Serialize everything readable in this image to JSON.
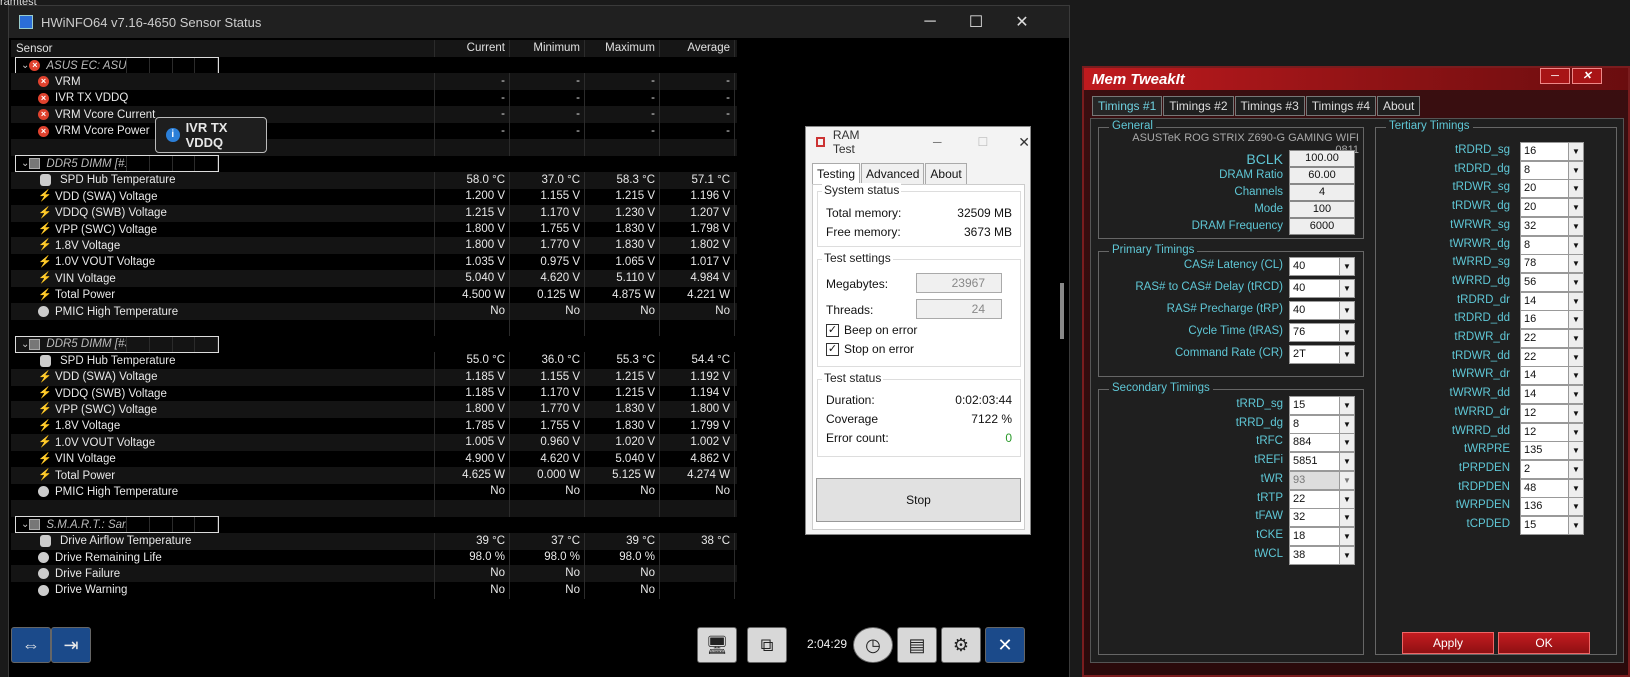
{
  "bg": {
    "text": "ramtest"
  },
  "hw": {
    "title": "HWiNFO64 v7.16-4650 Sensor Status",
    "columns": [
      "Sensor",
      "Current",
      "Minimum",
      "Maximum",
      "Average"
    ],
    "rows": [
      {
        "name": "ASUS EC: ASUS",
        "group": true,
        "icon": "x"
      },
      {
        "name": "VRM",
        "icon": "x",
        "cur": "-",
        "min": "-",
        "max": "-",
        "avg": "-"
      },
      {
        "name": "IVR TX VDDQ",
        "icon": "x",
        "cur": "-",
        "min": "-",
        "max": "-",
        "avg": "-"
      },
      {
        "name": "VRM Vcore Current",
        "icon": "x",
        "cur": "-",
        "min": "-",
        "max": "-",
        "avg": "-"
      },
      {
        "name": "VRM Vcore Power",
        "icon": "x",
        "cur": "-",
        "min": "-",
        "max": "-",
        "avg": "-"
      },
      {
        "name": "",
        "blank": true
      },
      {
        "name": "DDR5 DIMM [#1] (BANK 0/Controller1-DIMM1)",
        "group": true,
        "icon": "chip"
      },
      {
        "name": "SPD Hub Temperature",
        "icon": "t",
        "cur": "58.0 °C",
        "min": "37.0 °C",
        "max": "58.3 °C",
        "avg": "57.1 °C"
      },
      {
        "name": "VDD (SWA) Voltage",
        "icon": "b",
        "cur": "1.200 V",
        "min": "1.155 V",
        "max": "1.215 V",
        "avg": "1.196 V"
      },
      {
        "name": "VDDQ (SWB) Voltage",
        "icon": "b",
        "cur": "1.215 V",
        "min": "1.170 V",
        "max": "1.230 V",
        "avg": "1.207 V"
      },
      {
        "name": "VPP (SWC) Voltage",
        "icon": "b",
        "cur": "1.800 V",
        "min": "1.755 V",
        "max": "1.830 V",
        "avg": "1.798 V"
      },
      {
        "name": "1.8V Voltage",
        "icon": "b",
        "cur": "1.800 V",
        "min": "1.770 V",
        "max": "1.830 V",
        "avg": "1.802 V"
      },
      {
        "name": "1.0V VOUT Voltage",
        "icon": "b",
        "cur": "1.035 V",
        "min": "0.975 V",
        "max": "1.065 V",
        "avg": "1.017 V"
      },
      {
        "name": "VIN Voltage",
        "icon": "b",
        "cur": "5.040 V",
        "min": "4.620 V",
        "max": "5.110 V",
        "avg": "4.984 V"
      },
      {
        "name": "Total Power",
        "icon": "b",
        "cur": "4.500 W",
        "min": "0.125 W",
        "max": "4.875 W",
        "avg": "4.221 W"
      },
      {
        "name": "PMIC High Temperature",
        "icon": "c",
        "cur": "No",
        "min": "No",
        "max": "No",
        "avg": "No"
      },
      {
        "name": "",
        "blank": true
      },
      {
        "name": "DDR5 DIMM [#3]",
        "group": true,
        "icon": "chip"
      },
      {
        "name": "SPD Hub Temperature",
        "icon": "t",
        "cur": "55.0 °C",
        "min": "36.0 °C",
        "max": "55.3 °C",
        "avg": "54.4 °C"
      },
      {
        "name": "VDD (SWA) Voltage",
        "icon": "b",
        "cur": "1.185 V",
        "min": "1.155 V",
        "max": "1.215 V",
        "avg": "1.192 V"
      },
      {
        "name": "VDDQ (SWB) Voltage",
        "icon": "b",
        "cur": "1.185 V",
        "min": "1.170 V",
        "max": "1.215 V",
        "avg": "1.194 V"
      },
      {
        "name": "VPP (SWC) Voltage",
        "icon": "b",
        "cur": "1.800 V",
        "min": "1.770 V",
        "max": "1.830 V",
        "avg": "1.800 V"
      },
      {
        "name": "1.8V Voltage",
        "icon": "b",
        "cur": "1.785 V",
        "min": "1.755 V",
        "max": "1.830 V",
        "avg": "1.799 V"
      },
      {
        "name": "1.0V VOUT Voltage",
        "icon": "b",
        "cur": "1.005 V",
        "min": "0.960 V",
        "max": "1.020 V",
        "avg": "1.002 V"
      },
      {
        "name": "VIN Voltage",
        "icon": "b",
        "cur": "4.900 V",
        "min": "4.620 V",
        "max": "5.040 V",
        "avg": "4.862 V"
      },
      {
        "name": "Total Power",
        "icon": "b",
        "cur": "4.625 W",
        "min": "0.000 W",
        "max": "5.125 W",
        "avg": "4.274 W"
      },
      {
        "name": "PMIC High Temperature",
        "icon": "c",
        "cur": "No",
        "min": "No",
        "max": "No",
        "avg": "No"
      },
      {
        "name": "",
        "blank": true
      },
      {
        "name": "S.M.A.R.T.: Samsung SSD 850 EVO 1TB (S21DNXAG611410P)",
        "group": true,
        "icon": "chip"
      },
      {
        "name": "Drive Airflow Temperature",
        "icon": "t",
        "cur": "39 °C",
        "min": "37 °C",
        "max": "39 °C",
        "avg": "38 °C"
      },
      {
        "name": "Drive Remaining Life",
        "icon": "c",
        "cur": "98.0 %",
        "min": "98.0 %",
        "max": "98.0 %",
        "avg": ""
      },
      {
        "name": "Drive Failure",
        "icon": "c",
        "cur": "No",
        "min": "No",
        "max": "No",
        "avg": ""
      },
      {
        "name": "Drive Warning",
        "icon": "c",
        "cur": "No",
        "min": "No",
        "max": "No",
        "avg": ""
      }
    ],
    "tooltip": "IVR TX VDDQ",
    "clock": "2:04:29"
  },
  "rt": {
    "title": "RAM Test",
    "tabs": [
      "Testing",
      "Advanced",
      "About"
    ],
    "system_status": "System status",
    "total_memory_label": "Total memory:",
    "total_memory": "32509 MB",
    "free_memory_label": "Free memory:",
    "free_memory": "3673 MB",
    "test_settings": "Test settings",
    "megabytes_label": "Megabytes:",
    "megabytes": "23967",
    "threads_label": "Threads:",
    "threads": "24",
    "beep": "Beep on error",
    "stop_on_error": "Stop on error",
    "test_status": "Test status",
    "duration_label": "Duration:",
    "duration": "0:02:03:44",
    "coverage_label": "Coverage",
    "coverage": "7122 %",
    "errors_label": "Error count:",
    "errors": "0",
    "stop": "Stop"
  },
  "mt": {
    "title": "Mem TweakIt",
    "tabs": [
      "Timings #1",
      "Timings #2",
      "Timings #3",
      "Timings #4",
      "About"
    ],
    "general": "General",
    "board": "ASUSTeK ROG STRIX Z690-G GAMING WIFI 0811",
    "bclk_label": "BCLK",
    "bclk": "100.00",
    "ratio_label": "DRAM Ratio",
    "ratio": "60.00",
    "channels_label": "Channels",
    "channels": "4",
    "mode_label": "Mode",
    "mode": "100",
    "freq_label": "DRAM Frequency",
    "freq": "6000",
    "primary": "Primary Timings",
    "primary_items": [
      {
        "label": "CAS# Latency (CL)",
        "value": "40"
      },
      {
        "label": "RAS# to CAS# Delay (tRCD)",
        "value": "40"
      },
      {
        "label": "RAS# Precharge (tRP)",
        "value": "40"
      },
      {
        "label": "Cycle Time (tRAS)",
        "value": "76"
      },
      {
        "label": "Command Rate (CR)",
        "value": "2T"
      }
    ],
    "secondary": "Secondary Timings",
    "secondary_items": [
      {
        "label": "tRRD_sg",
        "value": "15"
      },
      {
        "label": "tRRD_dg",
        "value": "8"
      },
      {
        "label": "tRFC",
        "value": "884"
      },
      {
        "label": "tREFi",
        "value": "5851"
      },
      {
        "label": "tWR",
        "value": "93",
        "disabled": true
      },
      {
        "label": "tRTP",
        "value": "22"
      },
      {
        "label": "tFAW",
        "value": "32"
      },
      {
        "label": "tCKE",
        "value": "18"
      },
      {
        "label": "tWCL",
        "value": "38"
      }
    ],
    "tertiary": "Tertiary Timings",
    "tertiary_items": [
      {
        "label": "tRDRD_sg",
        "value": "16"
      },
      {
        "label": "tRDRD_dg",
        "value": "8"
      },
      {
        "label": "tRDWR_sg",
        "value": "20"
      },
      {
        "label": "tRDWR_dg",
        "value": "20"
      },
      {
        "label": "tWRWR_sg",
        "value": "32"
      },
      {
        "label": "tWRWR_dg",
        "value": "8"
      },
      {
        "label": "tWRRD_sg",
        "value": "78"
      },
      {
        "label": "tWRRD_dg",
        "value": "56"
      },
      {
        "label": "tRDRD_dr",
        "value": "14"
      },
      {
        "label": "tRDRD_dd",
        "value": "16"
      },
      {
        "label": "tRDWR_dr",
        "value": "22"
      },
      {
        "label": "tRDWR_dd",
        "value": "22"
      },
      {
        "label": "tWRWR_dr",
        "value": "14"
      },
      {
        "label": "tWRWR_dd",
        "value": "14"
      },
      {
        "label": "tWRRD_dr",
        "value": "12"
      },
      {
        "label": "tWRRD_dd",
        "value": "12"
      },
      {
        "label": "tWRPRE",
        "value": "135"
      },
      {
        "label": "tPRPDEN",
        "value": "2"
      },
      {
        "label": "tRDPDEN",
        "value": "48"
      },
      {
        "label": "tWRPDEN",
        "value": "136"
      },
      {
        "label": "tCPDED",
        "value": "15"
      }
    ],
    "apply": "Apply",
    "ok": "OK"
  }
}
